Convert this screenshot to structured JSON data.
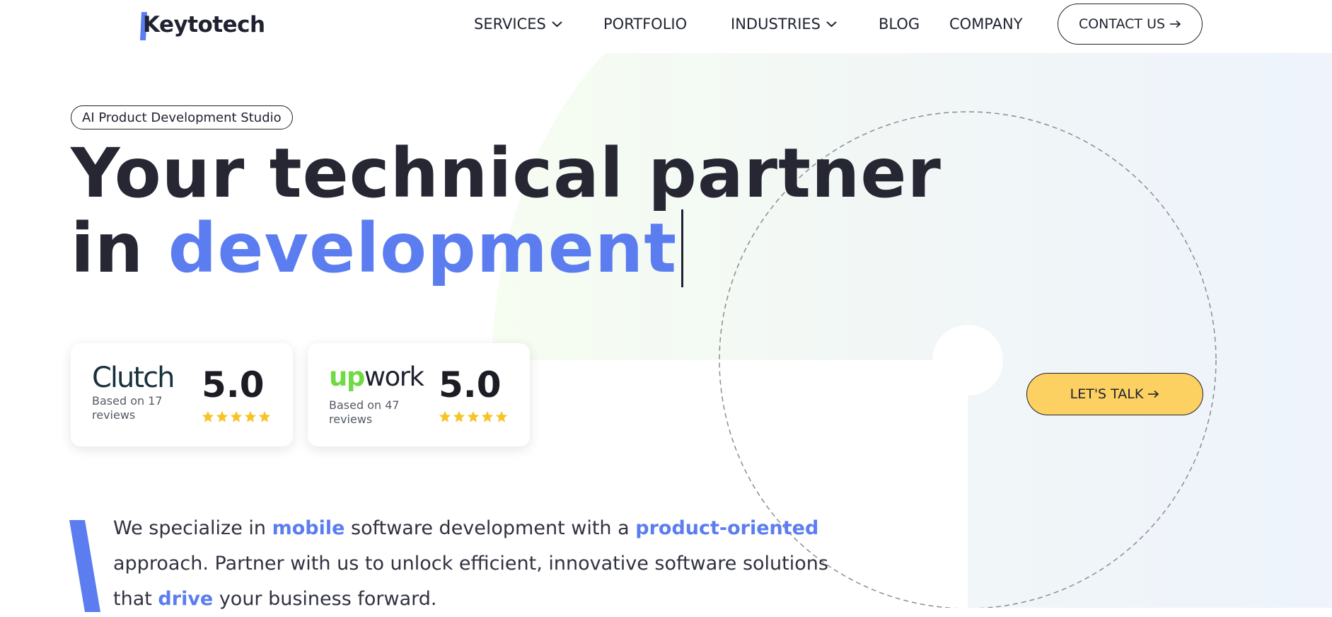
{
  "brand": {
    "logo_text": "Keytotech",
    "accent_color": "#5b7df0",
    "cta_color": "#fdd062"
  },
  "nav": {
    "items": [
      {
        "label": "SERVICES",
        "has_dropdown": true
      },
      {
        "label": "PORTFOLIO",
        "has_dropdown": false
      },
      {
        "label": "INDUSTRIES",
        "has_dropdown": true
      },
      {
        "label": "BLOG",
        "has_dropdown": false
      },
      {
        "label": "COMPANY",
        "has_dropdown": false
      }
    ],
    "contact_label": "CONTACT US",
    "contact_icon": "arrow-right-icon"
  },
  "hero": {
    "pill": "AI Product Development Studio",
    "headline_line1": "Your technical partner",
    "headline_line2_prefix": "in",
    "headline_line2_accent": "development"
  },
  "ratings": [
    {
      "platform": "Clutch",
      "note": "Based on 17 reviews",
      "score": "5.0",
      "stars": 5
    },
    {
      "platform_prefix": "up",
      "platform_suffix": "work",
      "note": "Based on 47 reviews",
      "score": "5.0",
      "stars": 5
    }
  ],
  "cta": {
    "label": "LET'S TALK",
    "icon": "arrow-right-icon"
  },
  "intro": {
    "p1": "We specialize in ",
    "hl1": "mobile",
    "p2": " software development with a ",
    "hl2": "product-oriented",
    "p3": " approach. Partner with us to unlock efficient, innovative software solutions that ",
    "hl3": "drive",
    "p4": " your business forward."
  }
}
